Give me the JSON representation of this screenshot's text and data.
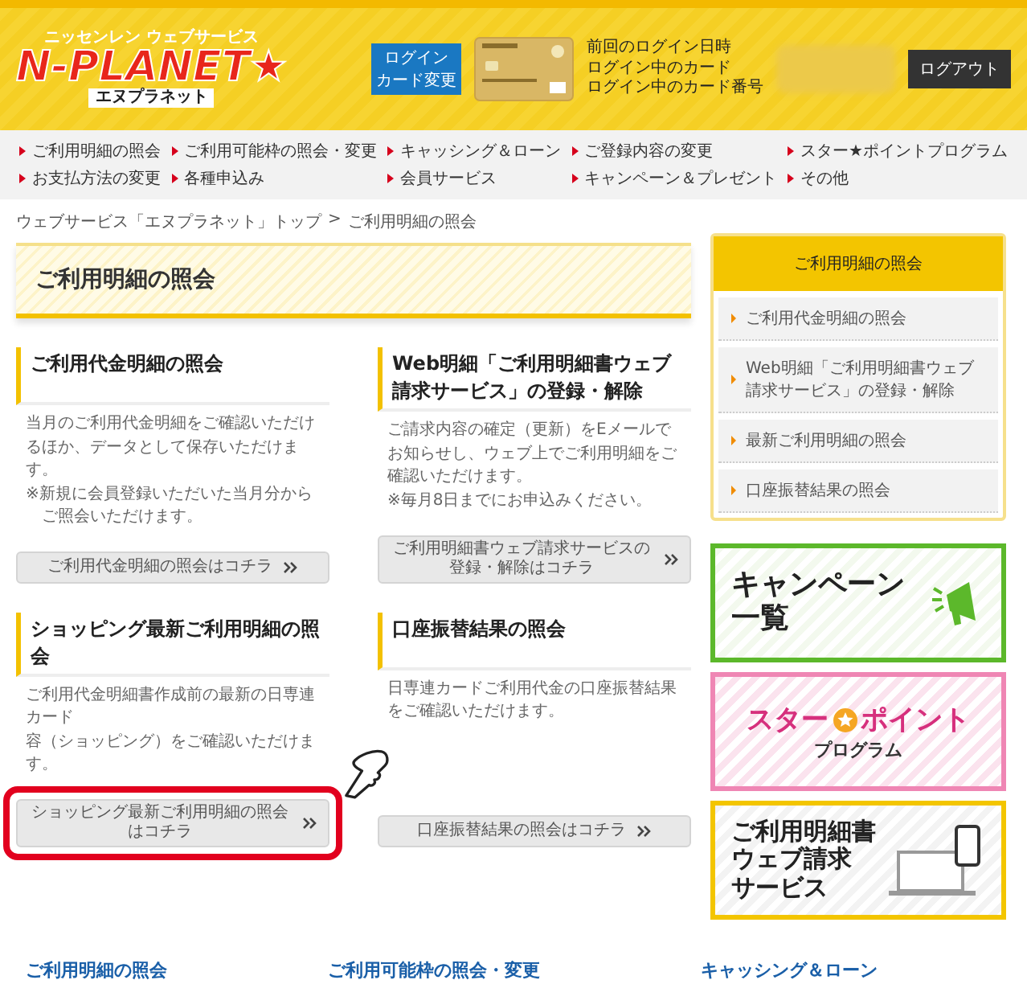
{
  "header": {
    "logo": {
      "tagline": "ニッセンレン ウェブサービス",
      "name": "N-PLANET★",
      "kana": "エヌプラネット"
    },
    "login_card_button": [
      "ログイン",
      "カード変更"
    ],
    "account_labels": [
      "前回のログイン日時",
      "ログイン中のカード",
      "ログイン中のカード番号"
    ],
    "logout_button": "ログアウト"
  },
  "nav": [
    {
      "label": "ご利用明細の照会"
    },
    {
      "label": "ご利用可能枠の照会・変更"
    },
    {
      "label": "キャッシング＆ローン"
    },
    {
      "label": "ご登録内容の変更"
    },
    {
      "label": "スター★ポイントプログラム"
    },
    {
      "label": "お支払方法の変更"
    },
    {
      "label": "各種申込み"
    },
    {
      "label": "会員サービス"
    },
    {
      "label": "キャンペーン＆プレゼント"
    },
    {
      "label": "その他"
    }
  ],
  "breadcrumb": {
    "items": [
      "ウェブサービス「エヌプラネット」トップ",
      "ご利用明細の照会"
    ],
    "separator": ">"
  },
  "page_title": "ご利用明細の照会",
  "sections": [
    {
      "title": "ご利用代金明細の照会",
      "body": [
        "当月のご利用代金明細をご確認いただけるほか、データとして保存いただけます。",
        "※新規に会員登録いただいた当月分からご照会いただけます。"
      ],
      "button": "ご利用代金明細の照会はコチラ",
      "highlighted": false
    },
    {
      "title": "Web明細「ご利用明細書ウェブ請求サービス」の登録・解除",
      "body": [
        "ご請求内容の確定（更新）をEメールでお知らせし、ウェブ上でご利用明細をご確認いただけます。",
        "※毎月8日までにお申込みください。"
      ],
      "button": "ご利用明細書ウェブ請求サービスの登録・解除はコチラ",
      "highlighted": false
    },
    {
      "title": "ショッピング最新ご利用明細の照会",
      "body": [
        "ご利用代金明細書作成前の最新の日専連カード",
        "容（ショッピング）をご確認いただけます。"
      ],
      "button": "ショッピング最新ご利用明細の照会はコチラ",
      "highlighted": true
    },
    {
      "title": "口座振替結果の照会",
      "body": [
        "日専連カードご利用代金の口座振替結果をご確認いただけます。"
      ],
      "button": "口座振替結果の照会はコチラ",
      "highlighted": false
    }
  ],
  "sidebar": {
    "title": "ご利用明細の照会",
    "items": [
      "ご利用代金明細の照会",
      "Web明細「ご利用明細書ウェブ請求サービス」の登録・解除",
      "最新ご利用明細の照会",
      "口座振替結果の照会"
    ]
  },
  "banners": [
    {
      "kind": "campaign",
      "lines": [
        "キャンペーン",
        "一覧"
      ]
    },
    {
      "kind": "star_point",
      "lines": [
        "スター",
        "ポイント",
        "プログラム"
      ]
    },
    {
      "kind": "web_bill",
      "lines": [
        "ご利用明細書",
        "ウェブ請求",
        "サービス"
      ]
    }
  ],
  "footer_links": [
    "ご利用明細の照会",
    "ご利用可能枠の照会・変更",
    "キャッシング＆ローン"
  ]
}
